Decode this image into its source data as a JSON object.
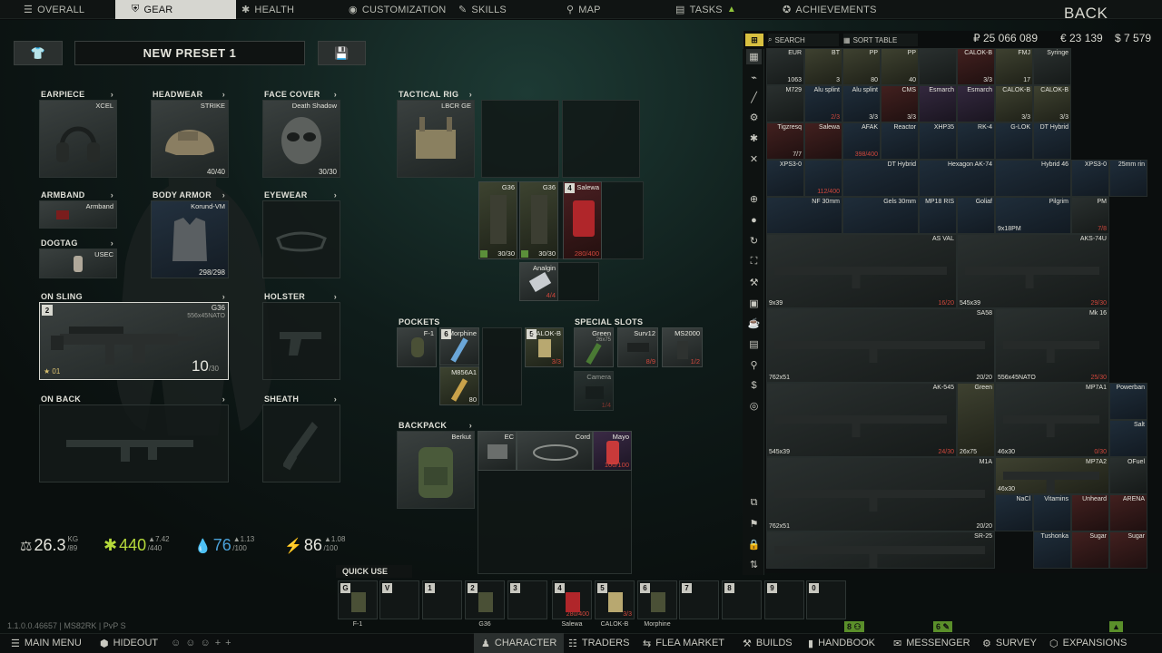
{
  "nav": {
    "tabs": [
      {
        "label": "OVERALL",
        "icon": "person-icon"
      },
      {
        "label": "GEAR",
        "icon": "shield-icon"
      },
      {
        "label": "HEALTH",
        "icon": "health-icon"
      },
      {
        "label": "CUSTOMIZATION",
        "icon": "customization-icon"
      },
      {
        "label": "SKILLS",
        "icon": "skills-icon"
      },
      {
        "label": "MAP",
        "icon": "map-pin-icon"
      },
      {
        "label": "TASKS",
        "icon": "tasks-icon"
      },
      {
        "label": "ACHIEVEMENTS",
        "icon": "achievements-icon"
      }
    ],
    "back": "BACK"
  },
  "preset": {
    "name": "NEW PRESET 1"
  },
  "gear": {
    "earpiece": {
      "label": "EARPIECE",
      "item": "XCEL"
    },
    "headwear": {
      "label": "HEADWEAR",
      "item": "STRIKE",
      "durability": "40/40"
    },
    "face_cover": {
      "label": "FACE COVER",
      "item": "Death Shadow",
      "durability": "30/30"
    },
    "armband": {
      "label": "ARMBAND",
      "item": "Armband"
    },
    "body_armor": {
      "label": "BODY ARMOR",
      "item": "Korund-VM",
      "durability": "298/298"
    },
    "eyewear": {
      "label": "EYEWEAR"
    },
    "dogtag": {
      "label": "DOGTAG",
      "item": "USEC"
    },
    "on_sling": {
      "label": "ON SLING",
      "item": "G36",
      "caliber": "556x45NATO",
      "ammo": "10",
      "ammo_max": "/30",
      "hotkey": "2",
      "fire_mode": "01"
    },
    "holster": {
      "label": "HOLSTER"
    },
    "on_back": {
      "label": "ON BACK"
    },
    "sheath": {
      "label": "SHEATH"
    },
    "tactical_rig": {
      "label": "TACTICAL RIG",
      "item": "LBCR GE"
    },
    "pockets": {
      "label": "POCKETS"
    },
    "special_slots": {
      "label": "SPECIAL SLOTS"
    },
    "backpack": {
      "label": "BACKPACK",
      "item": "Berkut"
    }
  },
  "rig_items": [
    {
      "name": "G36",
      "count": "30/30"
    },
    {
      "name": "G36",
      "count": "30/30"
    },
    {
      "name": "Salewa",
      "count": "280/400",
      "hotkey": "4"
    },
    {
      "name": "Analgin",
      "count": "4/4"
    }
  ],
  "pocket_items": [
    {
      "name": "F-1"
    },
    {
      "name": "Morphine",
      "hotkey": "6"
    },
    {
      "name": "M856A1",
      "count": "80"
    },
    {
      "name": "CALOK-B",
      "count": "3/3",
      "hotkey": "5"
    }
  ],
  "special_items": [
    {
      "name": "Green",
      "sub": "26x75"
    },
    {
      "name": "Surv12",
      "count": "8/9"
    },
    {
      "name": "MS2000",
      "count": "1/2"
    },
    {
      "name": "Camera",
      "count": "1/4"
    }
  ],
  "backpack_items": [
    {
      "name": "EC"
    },
    {
      "name": "Cord"
    },
    {
      "name": "Mayo",
      "count": "100/100"
    }
  ],
  "stats": {
    "weight": "26.3",
    "weight_unit": "KG",
    "weight_max": "/89",
    "health": "440",
    "health_delta": "7.42",
    "health_max": "/440",
    "hydration": "76",
    "hydration_delta": "1.13",
    "hydration_max": "/100",
    "energy": "86",
    "energy_delta": "1.08",
    "energy_max": "/100"
  },
  "quick_use": {
    "label": "QUICK USE",
    "slots": [
      {
        "key": "G",
        "label": "F-1"
      },
      {
        "key": "V",
        "label": ""
      },
      {
        "key": "1",
        "label": ""
      },
      {
        "key": "2",
        "label": "G36"
      },
      {
        "key": "3",
        "label": ""
      },
      {
        "key": "4",
        "label": "Salewa",
        "count": "280/400"
      },
      {
        "key": "5",
        "label": "CALOK-B",
        "count": "3/3"
      },
      {
        "key": "6",
        "label": "Morphine"
      },
      {
        "key": "7",
        "label": ""
      },
      {
        "key": "8",
        "label": ""
      },
      {
        "key": "9",
        "label": ""
      },
      {
        "key": "0",
        "label": ""
      }
    ]
  },
  "stash": {
    "search_label": "SEARCH",
    "sort_label": "SORT TABLE",
    "roubles": "₽ 25 066 089",
    "euros": "€ 23 139",
    "dollars": "$ 7 579",
    "row1": [
      {
        "name": "EUR",
        "count": "1063"
      },
      {
        "name": "BT",
        "count": "3"
      },
      {
        "name": "PP",
        "count": "80"
      },
      {
        "name": "PP",
        "count": "40"
      },
      {
        "name": ""
      },
      {
        "name": "CALOK-B",
        "count": "3/3"
      },
      {
        "name": "FMJ",
        "count": "17"
      },
      {
        "name": "Syringe",
        "count": ""
      }
    ],
    "row2": [
      {
        "name": "M729"
      },
      {
        "name": "Alu splint",
        "count": "2/3"
      },
      {
        "name": "Alu splint",
        "count": "3/3"
      },
      {
        "name": "CMS",
        "count": "3/3"
      },
      {
        "name": "Esmarch"
      },
      {
        "name": "Esmarch"
      },
      {
        "name": "CALOK-B",
        "count": "3/3"
      },
      {
        "name": "CALOK-B",
        "count": "3/3"
      }
    ],
    "row3": [
      {
        "name": "Tigzresq",
        "count": "7/7"
      },
      {
        "name": "Salewa",
        "count": ""
      },
      {
        "name": "AFAK",
        "count": "398/400"
      },
      {
        "name": "Reactor"
      },
      {
        "name": "XHP35"
      },
      {
        "name": "RK-4"
      },
      {
        "name": "G-LOK"
      },
      {
        "name": "DT Hybrid"
      }
    ],
    "row4": [
      {
        "name": "XPS3-0"
      },
      {
        "name": "",
        "count": "112/400"
      },
      {
        "name": "DT Hybrid"
      },
      {
        "name": "Hexagon AK-74"
      },
      {
        "name": "Hybrid 46"
      },
      {
        "name": "XPS3-0"
      },
      {
        "name": "25mm rin"
      }
    ],
    "row5": [
      {
        "name": "NF 30mm"
      },
      {
        "name": "Gels 30mm"
      },
      {
        "name": "MP18 RIS"
      },
      {
        "name": "Goliaf"
      },
      {
        "name": "Pilgrim",
        "cal": "9x18PM"
      },
      {
        "name": "PM",
        "count": "7/8"
      }
    ],
    "weapons": [
      {
        "name": "AS VAL",
        "cal": "9x39",
        "count": "16/20"
      },
      {
        "name": "AKS-74U",
        "cal": "545x39",
        "count": "29/30"
      },
      {
        "name": "SA58",
        "cal": "762x51",
        "count": "20/20"
      },
      {
        "name": "Mk 16",
        "cal": "556x45NATO",
        "count": "25/30"
      },
      {
        "name": "AK-545",
        "cal": "545x39",
        "count": "24/30"
      },
      {
        "name": "Green",
        "cal": "26x75"
      },
      {
        "name": "MP7A1",
        "cal": "46x30",
        "count": "0/30"
      },
      {
        "name": "Powerban"
      },
      {
        "name": "Salt"
      },
      {
        "name": "M1A",
        "cal": "762x51",
        "count": "20/20"
      },
      {
        "name": "MP7A2",
        "cal": "46x30"
      },
      {
        "name": "OFuel"
      },
      {
        "name": "NaCl"
      },
      {
        "name": "Vitamins"
      },
      {
        "name": "Unheard"
      },
      {
        "name": "ARENA"
      },
      {
        "name": "SR-25"
      },
      {
        "name": "Tushonka"
      },
      {
        "name": "Sugar"
      },
      {
        "name": "Sugar"
      }
    ]
  },
  "version": "1.1.0.0.46657 | MS82RK | PvP S",
  "counters": [
    {
      "value": "8"
    },
    {
      "value": "6"
    }
  ],
  "bottom": {
    "items": [
      {
        "label": "MAIN MENU",
        "icon": "menu-icon"
      },
      {
        "label": "HIDEOUT",
        "icon": "hideout-icon"
      },
      {
        "label": "CHARACTER",
        "icon": "character-icon"
      },
      {
        "label": "TRADERS",
        "icon": "traders-icon"
      },
      {
        "label": "FLEA MARKET",
        "icon": "flea-market-icon"
      },
      {
        "label": "BUILDS",
        "icon": "builds-icon"
      },
      {
        "label": "HANDBOOK",
        "icon": "handbook-icon"
      },
      {
        "label": "MESSENGER",
        "icon": "messenger-icon"
      },
      {
        "label": "SURVEY",
        "icon": "survey-icon"
      },
      {
        "label": "EXPANSIONS",
        "icon": "expansions-icon"
      }
    ]
  },
  "colors": {
    "accent_green": "#5b8f3a",
    "red": "#d0473c",
    "active_tab": "#d6d6d0"
  }
}
